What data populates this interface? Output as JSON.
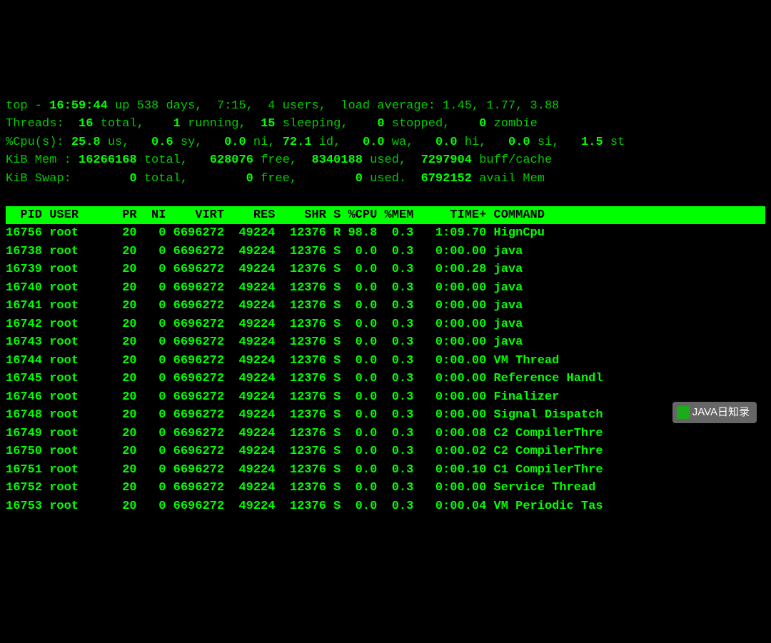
{
  "summary": {
    "line1_a": "top - ",
    "line1_b": "16:59:44 ",
    "line1_c": "up 538 days,  7:15,  4 users,  load average: 1.45, 1.77, 3.88",
    "line2_a": "Threads: ",
    "line2_b": " 16 ",
    "line2_c": "total,   ",
    "line2_d": " 1 ",
    "line2_e": "running,  ",
    "line2_f": "15 ",
    "line2_g": "sleeping,   ",
    "line2_h": " 0 ",
    "line2_i": "stopped,   ",
    "line2_j": " 0 ",
    "line2_k": "zombie",
    "line3_a": "%Cpu(s): ",
    "line3_b": "25.8 ",
    "line3_c": "us,  ",
    "line3_d": " 0.6 ",
    "line3_e": "sy,  ",
    "line3_f": " 0.0 ",
    "line3_g": "ni, ",
    "line3_h": "72.1 ",
    "line3_i": "id,  ",
    "line3_j": " 0.0 ",
    "line3_k": "wa,  ",
    "line3_l": " 0.0 ",
    "line3_m": "hi,  ",
    "line3_n": " 0.0 ",
    "line3_o": "si,  ",
    "line3_p": " 1.5 ",
    "line3_q": "st",
    "line4_a": "KiB Mem : ",
    "line4_b": "16266168 ",
    "line4_c": "total,   ",
    "line4_d": "628076 ",
    "line4_e": "free,  ",
    "line4_f": "8340188 ",
    "line4_g": "used,  ",
    "line4_h": "7297904 ",
    "line4_i": "buff/cache",
    "line5_a": "KiB Swap:        ",
    "line5_b": "0 ",
    "line5_c": "total,        ",
    "line5_d": "0 ",
    "line5_e": "free,        ",
    "line5_f": "0 ",
    "line5_g": "used.  ",
    "line5_h": "6792152 ",
    "line5_i": "avail Mem"
  },
  "header": "  PID USER      PR  NI    VIRT    RES    SHR S %CPU %MEM     TIME+ COMMAND         ",
  "rows": [
    {
      "pid": "16756",
      "user": "root",
      "pr": "20",
      "ni": "0",
      "virt": "6696272",
      "res": "49224",
      "shr": "12376",
      "s": "R",
      "cpu": "98.8",
      "mem": "0.3",
      "time": "1:09.70",
      "cmd": "HignCpu"
    },
    {
      "pid": "16738",
      "user": "root",
      "pr": "20",
      "ni": "0",
      "virt": "6696272",
      "res": "49224",
      "shr": "12376",
      "s": "S",
      "cpu": " 0.0",
      "mem": "0.3",
      "time": "0:00.00",
      "cmd": "java"
    },
    {
      "pid": "16739",
      "user": "root",
      "pr": "20",
      "ni": "0",
      "virt": "6696272",
      "res": "49224",
      "shr": "12376",
      "s": "S",
      "cpu": " 0.0",
      "mem": "0.3",
      "time": "0:00.28",
      "cmd": "java"
    },
    {
      "pid": "16740",
      "user": "root",
      "pr": "20",
      "ni": "0",
      "virt": "6696272",
      "res": "49224",
      "shr": "12376",
      "s": "S",
      "cpu": " 0.0",
      "mem": "0.3",
      "time": "0:00.00",
      "cmd": "java"
    },
    {
      "pid": "16741",
      "user": "root",
      "pr": "20",
      "ni": "0",
      "virt": "6696272",
      "res": "49224",
      "shr": "12376",
      "s": "S",
      "cpu": " 0.0",
      "mem": "0.3",
      "time": "0:00.00",
      "cmd": "java"
    },
    {
      "pid": "16742",
      "user": "root",
      "pr": "20",
      "ni": "0",
      "virt": "6696272",
      "res": "49224",
      "shr": "12376",
      "s": "S",
      "cpu": " 0.0",
      "mem": "0.3",
      "time": "0:00.00",
      "cmd": "java"
    },
    {
      "pid": "16743",
      "user": "root",
      "pr": "20",
      "ni": "0",
      "virt": "6696272",
      "res": "49224",
      "shr": "12376",
      "s": "S",
      "cpu": " 0.0",
      "mem": "0.3",
      "time": "0:00.00",
      "cmd": "java"
    },
    {
      "pid": "16744",
      "user": "root",
      "pr": "20",
      "ni": "0",
      "virt": "6696272",
      "res": "49224",
      "shr": "12376",
      "s": "S",
      "cpu": " 0.0",
      "mem": "0.3",
      "time": "0:00.00",
      "cmd": "VM Thread"
    },
    {
      "pid": "16745",
      "user": "root",
      "pr": "20",
      "ni": "0",
      "virt": "6696272",
      "res": "49224",
      "shr": "12376",
      "s": "S",
      "cpu": " 0.0",
      "mem": "0.3",
      "time": "0:00.00",
      "cmd": "Reference Handl"
    },
    {
      "pid": "16746",
      "user": "root",
      "pr": "20",
      "ni": "0",
      "virt": "6696272",
      "res": "49224",
      "shr": "12376",
      "s": "S",
      "cpu": " 0.0",
      "mem": "0.3",
      "time": "0:00.00",
      "cmd": "Finalizer"
    },
    {
      "pid": "16748",
      "user": "root",
      "pr": "20",
      "ni": "0",
      "virt": "6696272",
      "res": "49224",
      "shr": "12376",
      "s": "S",
      "cpu": " 0.0",
      "mem": "0.3",
      "time": "0:00.00",
      "cmd": "Signal Dispatch"
    },
    {
      "pid": "16749",
      "user": "root",
      "pr": "20",
      "ni": "0",
      "virt": "6696272",
      "res": "49224",
      "shr": "12376",
      "s": "S",
      "cpu": " 0.0",
      "mem": "0.3",
      "time": "0:00.08",
      "cmd": "C2 CompilerThre"
    },
    {
      "pid": "16750",
      "user": "root",
      "pr": "20",
      "ni": "0",
      "virt": "6696272",
      "res": "49224",
      "shr": "12376",
      "s": "S",
      "cpu": " 0.0",
      "mem": "0.3",
      "time": "0:00.02",
      "cmd": "C2 CompilerThre"
    },
    {
      "pid": "16751",
      "user": "root",
      "pr": "20",
      "ni": "0",
      "virt": "6696272",
      "res": "49224",
      "shr": "12376",
      "s": "S",
      "cpu": " 0.0",
      "mem": "0.3",
      "time": "0:00.10",
      "cmd": "C1 CompilerThre"
    },
    {
      "pid": "16752",
      "user": "root",
      "pr": "20",
      "ni": "0",
      "virt": "6696272",
      "res": "49224",
      "shr": "12376",
      "s": "S",
      "cpu": " 0.0",
      "mem": "0.3",
      "time": "0:00.00",
      "cmd": "Service Thread"
    },
    {
      "pid": "16753",
      "user": "root",
      "pr": "20",
      "ni": "0",
      "virt": "6696272",
      "res": "49224",
      "shr": "12376",
      "s": "S",
      "cpu": " 0.0",
      "mem": "0.3",
      "time": "0:00.04",
      "cmd": "VM Periodic Tas"
    }
  ],
  "watermark": "JAVA日知录"
}
